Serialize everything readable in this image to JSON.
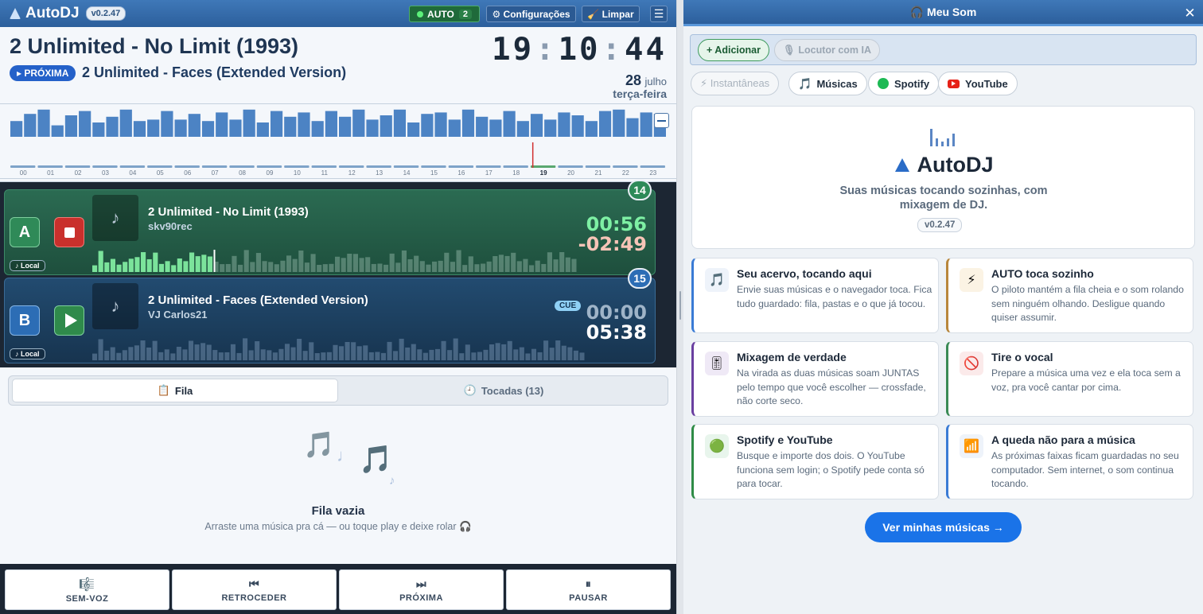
{
  "app": {
    "name": "AutoDJ",
    "version": "v0.2.47"
  },
  "toolbar": {
    "auto_label": "AUTO",
    "auto_count": "2",
    "settings_label": "⚙ Configurações",
    "clear_label": "🧹 Limpar"
  },
  "now_playing": {
    "title": "2 Unlimited - No Limit (1993)",
    "next_badge": "▸ PRÓXIMA",
    "next_title": "2 Unlimited - Faces (Extended Version)",
    "clock": {
      "h": "19",
      "m": "10",
      "s": "44"
    },
    "date": {
      "day": "28",
      "month": "julho",
      "weekday": "terça-feira"
    }
  },
  "hours": {
    "labels": [
      "00",
      "01",
      "02",
      "03",
      "04",
      "05",
      "06",
      "07",
      "08",
      "09",
      "10",
      "11",
      "12",
      "13",
      "14",
      "15",
      "16",
      "17",
      "18",
      "19",
      "20",
      "21",
      "22",
      "23"
    ],
    "current": "19",
    "activity": [
      0.55,
      0.8,
      0.95,
      0.4,
      0.75,
      0.9,
      0.5,
      0.7,
      0.95,
      0.55,
      0.6,
      0.9,
      0.6,
      0.8,
      0.55,
      0.85,
      0.6,
      0.95,
      0.5,
      0.9,
      0.7,
      0.85,
      0.55,
      0.9,
      0.7,
      0.95,
      0.6,
      0.75,
      0.95,
      0.5,
      0.8,
      0.85,
      0.6,
      0.95,
      0.7,
      0.6,
      0.9,
      0.55,
      0.8,
      0.6,
      0.85,
      0.75,
      0.55,
      0.9,
      0.95,
      0.65,
      0.85,
      0.8
    ]
  },
  "deck_a": {
    "letter": "A",
    "title": "2 Unlimited - No Limit (1993)",
    "artist": "skv90rec",
    "source": "♪ Local",
    "elapsed": "00:56",
    "remaining": "-02:49",
    "queue_number": "14",
    "progress": 0.25
  },
  "deck_b": {
    "letter": "B",
    "title": "2 Unlimited - Faces (Extended Version)",
    "artist": "VJ Carlos21",
    "source": "♪ Local",
    "cue": "CUE",
    "elapsed": "00:00",
    "remaining": "05:38",
    "queue_number": "15",
    "progress": 0
  },
  "queue_tabs": {
    "queue": "Fila",
    "played": "Tocadas (13)"
  },
  "empty_queue": {
    "title": "Fila vazia",
    "subtitle": "Arraste uma música pra cá — ou toque play e deixe rolar 🎧"
  },
  "bottom_controls": [
    {
      "label": "SEM-VOZ",
      "icon": "🎼"
    },
    {
      "label": "RETROCEDER",
      "icon": "⏮"
    },
    {
      "label": "PRÓXIMA",
      "icon": "⏭"
    },
    {
      "label": "PAUSAR",
      "icon": "⏸"
    }
  ],
  "panel": {
    "title": "🎧 Meu Som",
    "add_label": "+ Adicionar",
    "ai_label": "🎙 Locutor com IA",
    "sources": {
      "instant": "⚡ Instantâneas",
      "music": "Músicas",
      "spotify": "Spotify",
      "youtube": "YouTube"
    },
    "hero": {
      "title": "AutoDJ",
      "tagline": "Suas músicas tocando sozinhas, com mixagem de DJ.",
      "version": "v0.2.47"
    },
    "cards": [
      {
        "title": "Seu acervo, tocando aqui",
        "desc": "Envie suas músicas e o navegador toca. Fica tudo guardado: fila, pastas e o que já tocou.",
        "icon": "🎵",
        "accent": "#3a7bd5"
      },
      {
        "title": "AUTO toca sozinho",
        "desc": "O piloto mantém a fila cheia e o som rolando sem ninguém olhando. Desligue quando quiser assumir.",
        "icon": "⚡",
        "accent": "#b8863b"
      },
      {
        "title": "Mixagem de verdade",
        "desc": "Na virada as duas músicas soam JUNTAS pelo tempo que você escolher — crossfade, não corte seco.",
        "icon": "🎚",
        "accent": "#6a3fa0"
      },
      {
        "title": "Tire o vocal",
        "desc": "Prepare a música uma vez e ela toca sem a voz, pra você cantar por cima.",
        "icon": "🚫",
        "accent": "#3a8a55"
      },
      {
        "title": "Spotify e YouTube",
        "desc": "Busque e importe dos dois. O YouTube funciona sem login; o Spotify pede conta só para tocar.",
        "icon": "🟢",
        "accent": "#2e8b46"
      },
      {
        "title": "A queda não para a música",
        "desc": "As próximas faixas ficam guardadas no seu computador. Sem internet, o som continua tocando.",
        "icon": "📶",
        "accent": "#3a7bd5"
      }
    ],
    "cta": "Ver minhas músicas →"
  }
}
